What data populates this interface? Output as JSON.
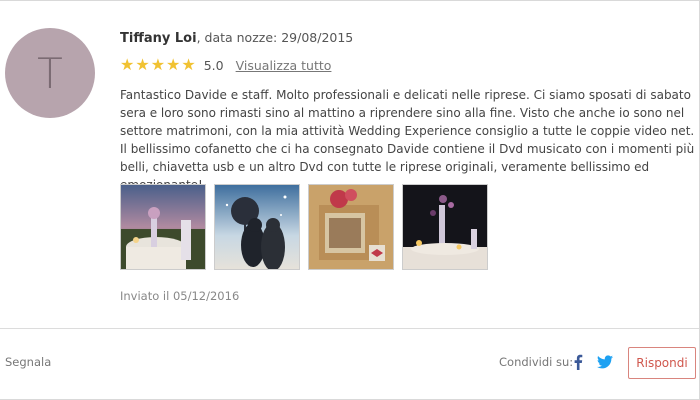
{
  "review": {
    "avatar_initial": "T",
    "author": "Tiffany Loi",
    "meta": ", data nozze: 29/08/2015",
    "stars": 5,
    "rating": "5.0",
    "view_all": "Visualizza tutto",
    "text": "Fantastico Davide e staff. Molto professionali e delicati nelle riprese. Ci siamo sposati di sabato sera e loro sono rimasti sino al mattino a riprendere sino alla fine. Visto che anche io sono nel settore matrimoni, con la mia attività Wedding Experience consiglio a tutte le coppie video net. Il bellissimo cofanetto che ci ha consegnato Davide contiene il Dvd musicato con i momenti più belli, chiavetta usb e un altro Dvd con tutte le riprese originali, veramente bellissimo ed emozionante!",
    "sent": "Inviato il 05/12/2016"
  },
  "footer": {
    "report": "Segnala",
    "share_label": "Condividi su:",
    "reply": "Rispondi"
  },
  "colors": {
    "star": "#f1c232",
    "avatar_bg": "#b7a4ad",
    "reply_accent": "#d0574d",
    "facebook": "#3b5998",
    "twitter": "#1da1f2"
  }
}
